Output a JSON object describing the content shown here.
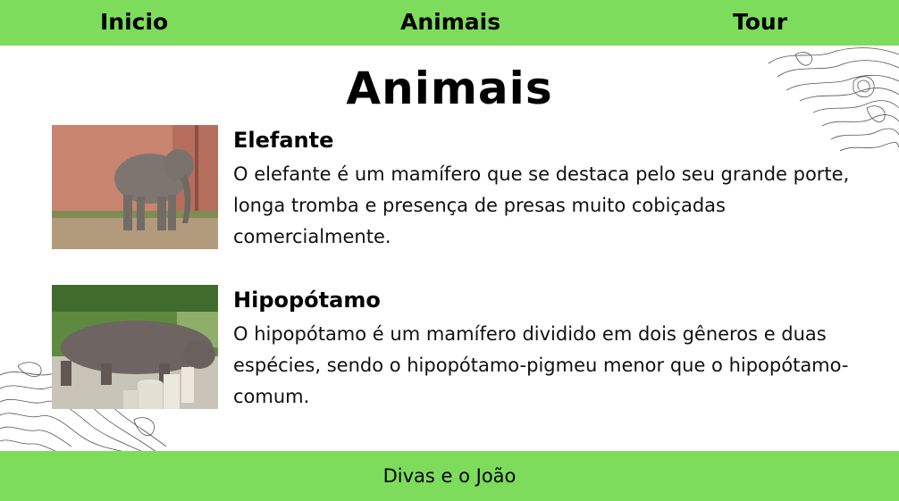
{
  "nav": {
    "home": "Inicio",
    "animals": "Animais",
    "tour": "Tour"
  },
  "page": {
    "title": "Animais"
  },
  "animals": [
    {
      "name": "Elefante",
      "description": "O elefante é um mamífero que se destaca pelo seu grande porte, longa tromba e presença de presas muito cobiçadas comercialmente."
    },
    {
      "name": "Hipopótamo",
      "description": "O hipopótamo é um mamífero dividido em dois gêneros e duas espécies, sendo o hipopótamo-pigmeu menor que o hipopótamo-comum."
    }
  ],
  "footer": {
    "text": "Divas e o João"
  },
  "colors": {
    "accent": "#7ddc5c"
  }
}
